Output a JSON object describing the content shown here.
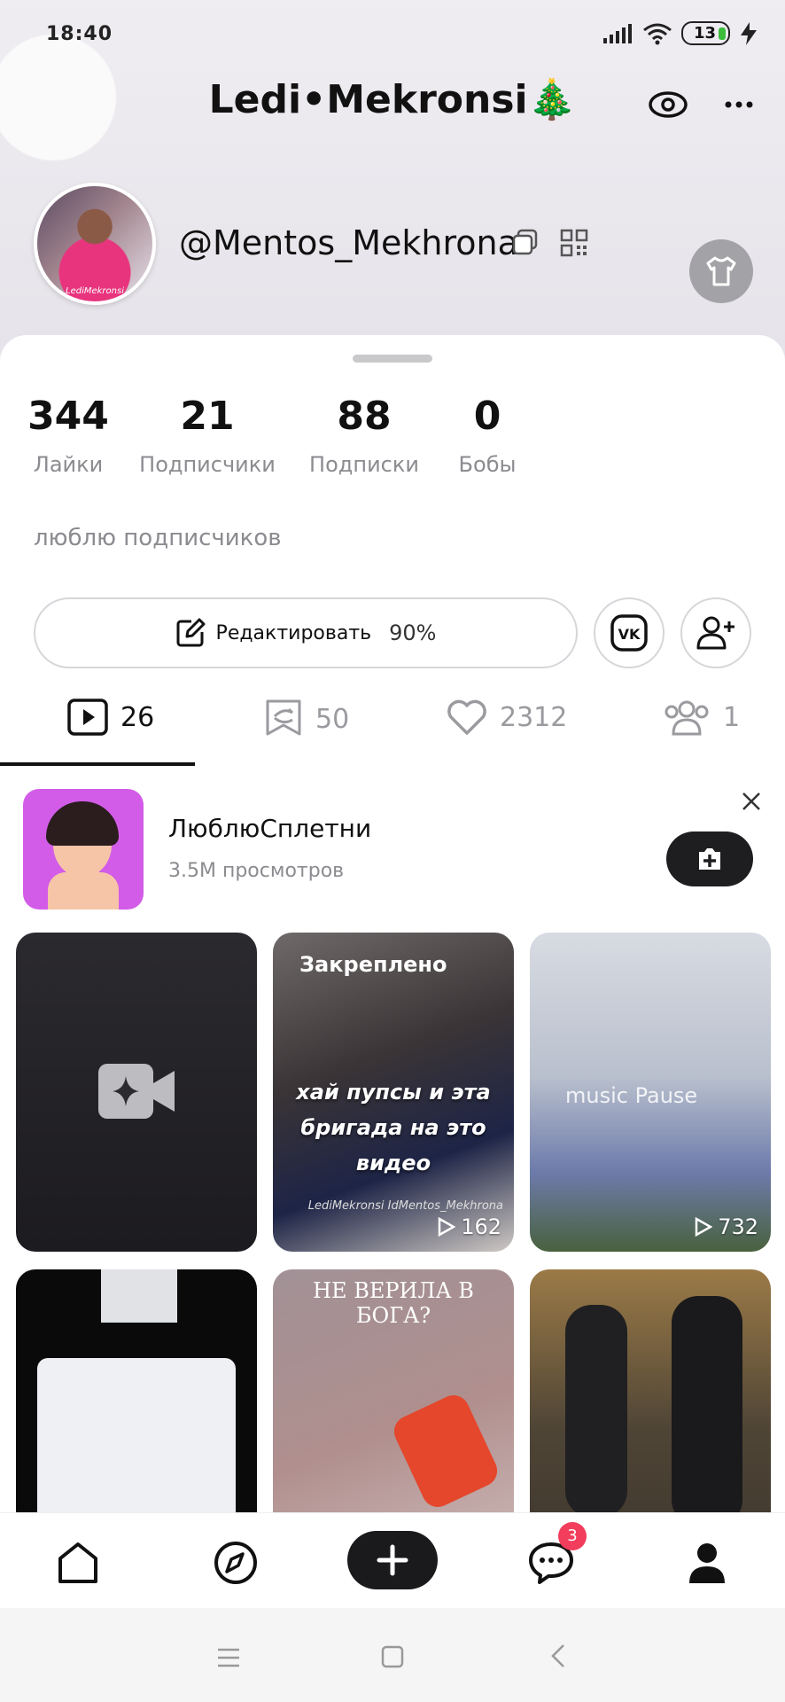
{
  "status_bar": {
    "time": "18:40",
    "battery": "13"
  },
  "header": {
    "title": "Ledi•Mekronsi🎄",
    "username": "@Mentos_Mekhrona",
    "avatar_caption": "LediMekronsi"
  },
  "stats": [
    {
      "value": "344",
      "label": "Лайки"
    },
    {
      "value": "21",
      "label": "Подписчики"
    },
    {
      "value": "88",
      "label": "Подписки"
    },
    {
      "value": "0",
      "label": "Бобы"
    }
  ],
  "bio": "люблю подписчиков",
  "edit": {
    "label": "Редактировать",
    "percent": "90%"
  },
  "tabs": [
    {
      "icon": "video-play-icon",
      "count": "26"
    },
    {
      "icon": "repost-icon",
      "count": "50"
    },
    {
      "icon": "heart-icon",
      "count": "2312"
    },
    {
      "icon": "friends-icon",
      "count": "1"
    }
  ],
  "promo": {
    "title": "ЛюблюСплетни",
    "subtitle": "3.5M просмотров"
  },
  "videos": [
    {
      "type": "create"
    },
    {
      "pinned": "Закреплено",
      "overlay": "хай пупсы и эта бригада на это видео",
      "views": "162",
      "watermark": "LediMekronsi\nIdMentos_Mekhrona"
    },
    {
      "overlay": "music Pause",
      "views": "732"
    },
    {
      "type": "screenshot"
    },
    {
      "caption": "НЕ ВЕРИЛА В БОГА?"
    },
    {
      "type": "image"
    }
  ],
  "bottom_nav": {
    "messages_badge": "3"
  },
  "colors": {
    "accent": "#f23d5c",
    "dark": "#1a1a1c",
    "muted": "#8b8b90"
  }
}
